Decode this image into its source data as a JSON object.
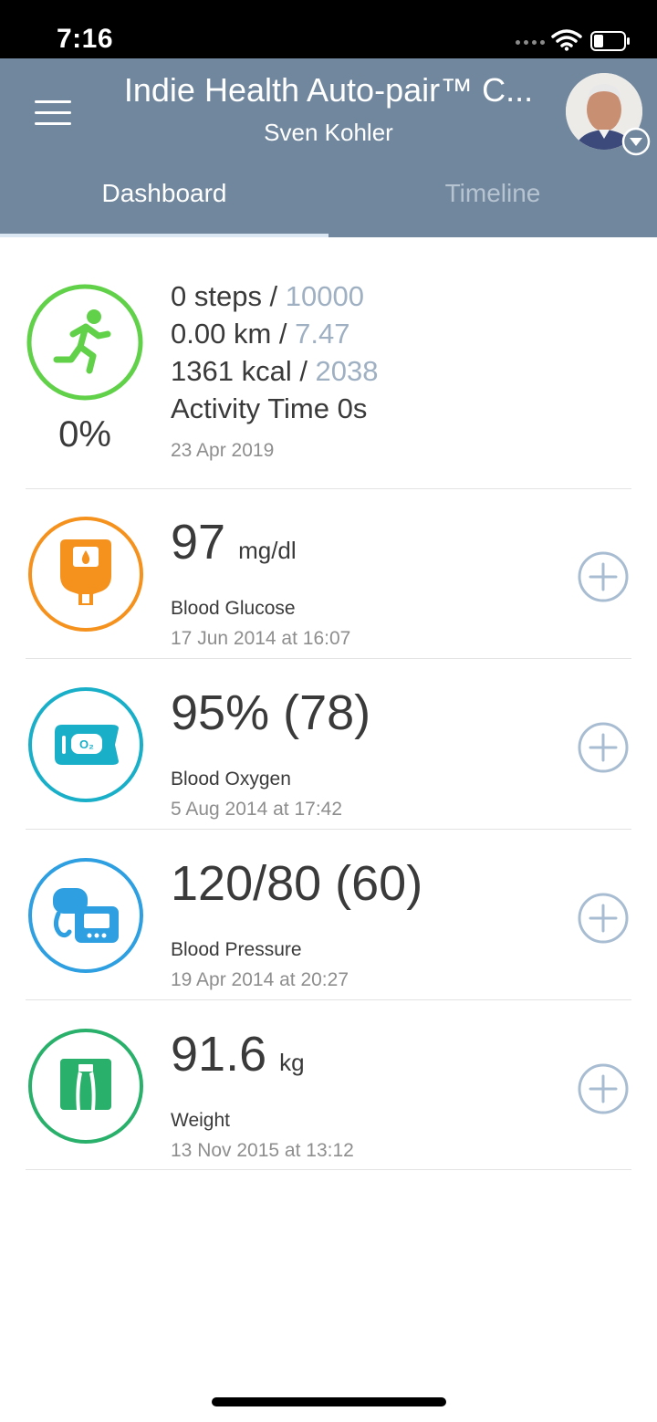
{
  "status_bar": {
    "time": "7:16"
  },
  "header": {
    "title": "Indie Health Auto-pair™ C...",
    "subtitle": "Sven Kohler",
    "tabs": [
      {
        "label": "Dashboard",
        "active": true
      },
      {
        "label": "Timeline",
        "active": false
      }
    ],
    "color": "#71879e"
  },
  "activity": {
    "steps": "0 steps / ",
    "steps_goal": "10000",
    "distance": "0.00 km / ",
    "distance_goal": "7.47",
    "calories": "1361 kcal / ",
    "calories_goal": "2038",
    "activity_time": "Activity Time 0s",
    "percent": "0%",
    "date": "23 Apr 2019",
    "icon": "running-person-icon",
    "color": "#62d14a"
  },
  "metrics": [
    {
      "value": "97",
      "unit": "mg/dl",
      "label": "Blood Glucose",
      "date": "17 Jun 2014 at 16:07",
      "icon": "glucose-meter-icon",
      "color": "#f5921e"
    },
    {
      "value": "95% (78)",
      "unit": "",
      "label": "Blood Oxygen",
      "date": "5 Aug 2014 at 17:42",
      "icon": "pulse-oximeter-icon",
      "color": "#1aafc8"
    },
    {
      "value": "120/80 (60)",
      "unit": "",
      "label": "Blood Pressure",
      "date": "19 Apr 2014 at 20:27",
      "icon": "blood-pressure-monitor-icon",
      "color": "#2e9fe0"
    },
    {
      "value": "91.6",
      "unit": "kg",
      "label": "Weight",
      "date": "13 Nov 2015 at 13:12",
      "icon": "scale-icon",
      "color": "#29b06a"
    }
  ],
  "accent_goal_color": "#9fb0c3",
  "add_button_color": "#a9bdd2"
}
